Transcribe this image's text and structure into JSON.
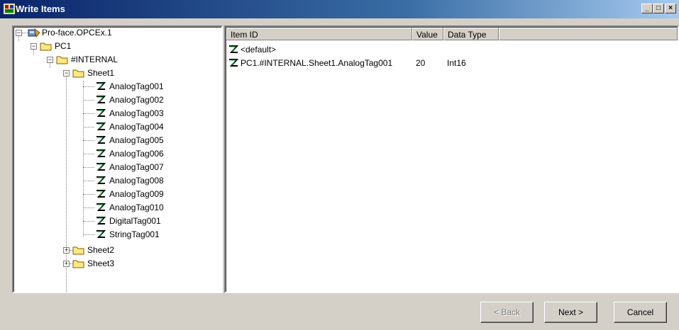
{
  "window": {
    "title": "Write Items",
    "controls": {
      "minimize": "_",
      "maximize": "□",
      "close": "×"
    }
  },
  "tree": {
    "root": "Pro-face.OPCEx.1",
    "pc": "PC1",
    "internal": "#INTERNAL",
    "sheet1": "Sheet1",
    "tags": [
      "AnalogTag001",
      "AnalogTag002",
      "AnalogTag003",
      "AnalogTag004",
      "AnalogTag005",
      "AnalogTag006",
      "AnalogTag007",
      "AnalogTag008",
      "AnalogTag009",
      "AnalogTag010",
      "DigitalTag001",
      "StringTag001"
    ],
    "sheet2": "Sheet2",
    "sheet3": "Sheet3",
    "expanded_glyph": "−",
    "collapsed_glyph": "+"
  },
  "list": {
    "columns": [
      "Item ID",
      "Value",
      "Data Type"
    ],
    "rows": [
      {
        "item_id": "<default>",
        "value": "",
        "type": ""
      },
      {
        "item_id": "PC1.#INTERNAL.Sheet1.AnalogTag001",
        "value": "20",
        "type": "Int16"
      }
    ]
  },
  "buttons": {
    "back": "< Back",
    "next": "Next >",
    "cancel": "Cancel"
  },
  "colors": {
    "title_start": "#0a246a",
    "title_end": "#a6caf0",
    "face": "#d4d0c8",
    "folder": "#ffe880"
  }
}
